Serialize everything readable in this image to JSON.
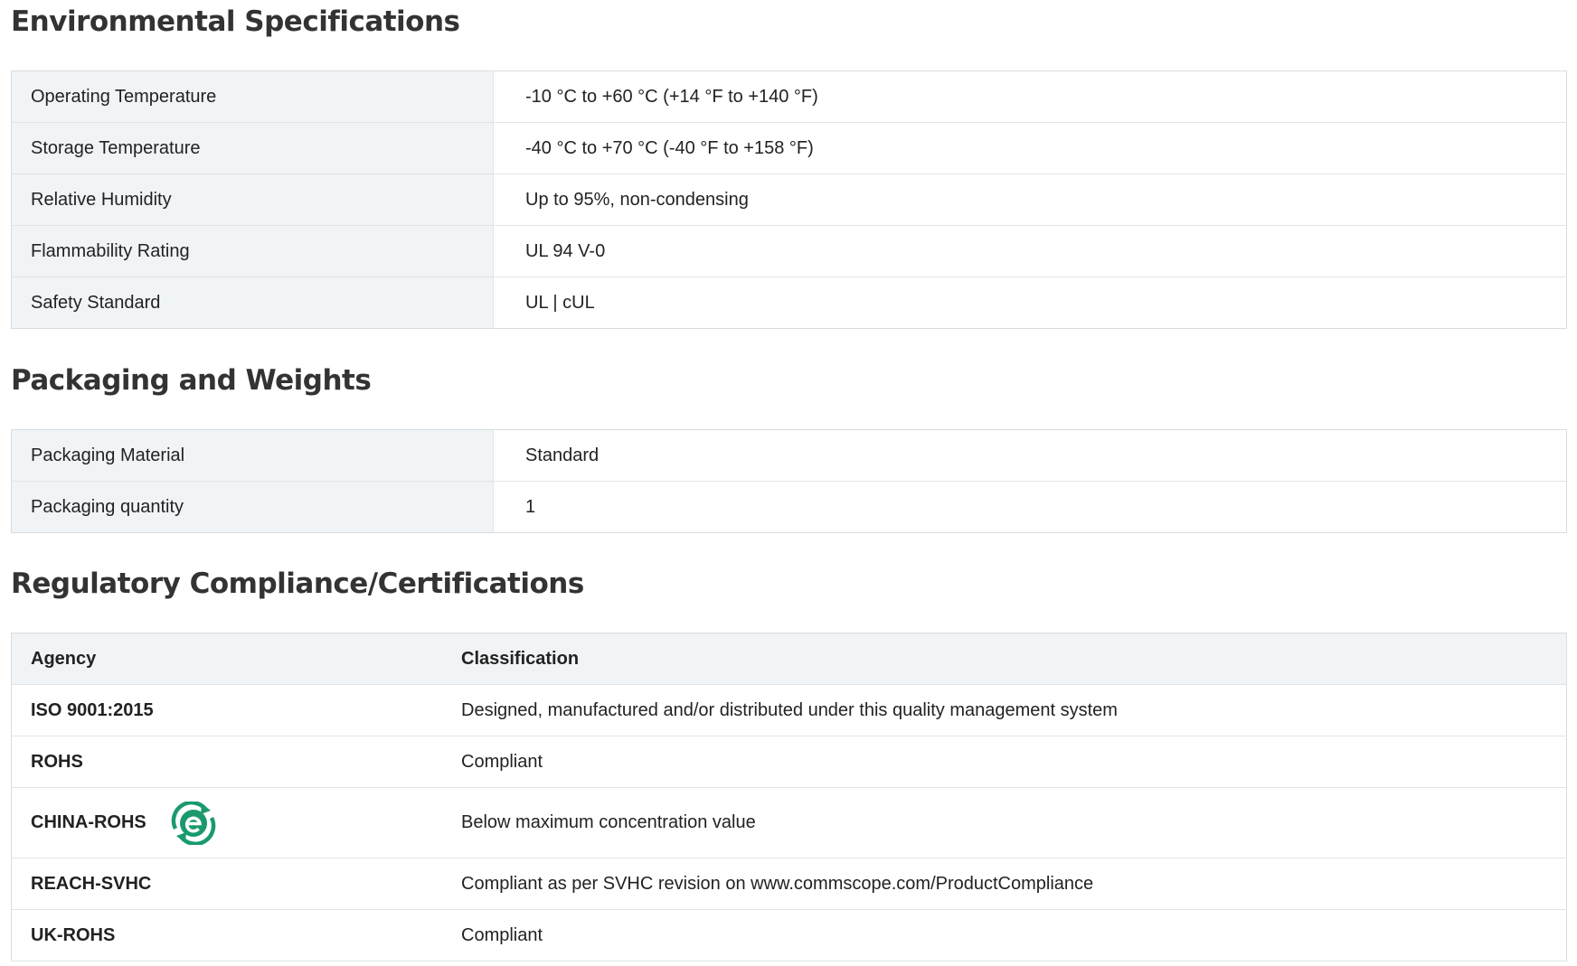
{
  "sections": {
    "environmental": {
      "title": "Environmental Specifications",
      "rows": [
        {
          "label": "Operating Temperature",
          "value": "-10 °C to +60 °C (+14 °F to +140 °F)"
        },
        {
          "label": "Storage Temperature",
          "value": "-40 °C to +70 °C (-40 °F to +158 °F)"
        },
        {
          "label": "Relative Humidity",
          "value": "Up to 95%, non-condensing"
        },
        {
          "label": "Flammability Rating",
          "value": "UL 94 V-0"
        },
        {
          "label": "Safety Standard",
          "value": "UL | cUL"
        }
      ]
    },
    "packaging": {
      "title": "Packaging and Weights",
      "rows": [
        {
          "label": "Packaging Material",
          "value": "Standard"
        },
        {
          "label": "Packaging quantity",
          "value": "1"
        }
      ]
    },
    "regulatory": {
      "title": "Regulatory Compliance/Certifications",
      "headers": {
        "agency": "Agency",
        "classification": "Classification"
      },
      "rows": [
        {
          "agency": "ISO 9001:2015",
          "classification": "Designed, manufactured and/or distributed under this quality management system"
        },
        {
          "agency": "ROHS",
          "classification": "Compliant"
        },
        {
          "agency": "CHINA-ROHS",
          "classification": "Below maximum concentration value",
          "icon": "china-rohs-e-icon"
        },
        {
          "agency": "REACH-SVHC",
          "classification": "Compliant as per SVHC revision on www.commscope.com/ProductCompliance"
        },
        {
          "agency": "UK-ROHS",
          "classification": "Compliant"
        }
      ]
    }
  },
  "colors": {
    "label_background": "#f0f4f6",
    "border": "#d9dde0",
    "china_rohs_icon": "#1a9a6c",
    "heading_text": "#333333"
  }
}
